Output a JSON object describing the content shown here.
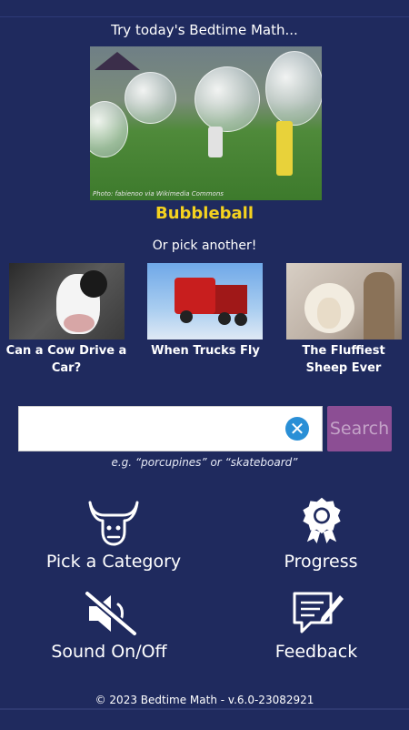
{
  "intro": "Try today's Bedtime Math...",
  "feature": {
    "title": "Bubbleball",
    "credit": "Photo: fabienoo via Wikimedia Commons"
  },
  "or_pick": "Or pick another!",
  "thumbnails": [
    {
      "title": "Can a Cow Drive a Car?"
    },
    {
      "title": "When Trucks Fly"
    },
    {
      "title": "The Fluffiest Sheep Ever"
    }
  ],
  "search": {
    "value": "",
    "placeholder": "",
    "button": "Search",
    "hint": "e.g. “porcupines” or “skateboard”"
  },
  "menu": {
    "category": "Pick a Category",
    "progress": "Progress",
    "sound": "Sound On/Off",
    "feedback": "Feedback"
  },
  "footer": "© 2023 Bedtime Math  -  v.6.0-23082921",
  "colors": {
    "background": "#1f2a5e",
    "title_yellow": "#f4d21f",
    "search_button": "#8c4e94",
    "clear_icon": "#2a8fd6"
  }
}
